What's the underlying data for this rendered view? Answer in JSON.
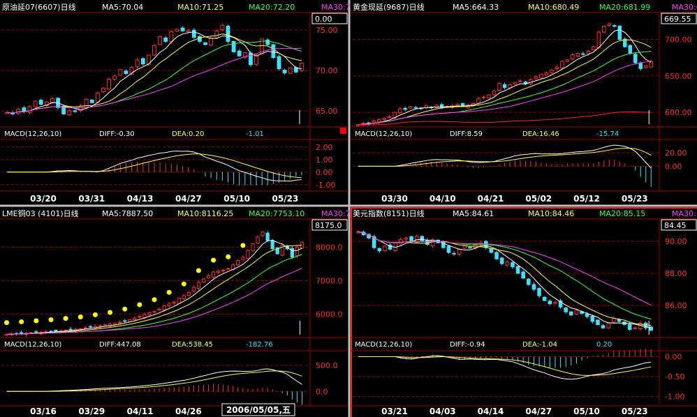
{
  "colors": {
    "up": "#ff3030",
    "down": "#40e0ff",
    "ma5": "#ffffff",
    "ma10": "#ffff40",
    "ma20": "#40ff40",
    "ma30": "#ff40ff",
    "grid": "#a00000",
    "axis_text": "#ff3030",
    "date_text": "#ffffff",
    "diff_line": "#ffffff",
    "dea_line": "#ffff40",
    "dot": "#ffff00"
  },
  "panels": [
    {
      "title": "原油延07(6607)日线",
      "ma5": "MA5:70.04",
      "ma10": "MA10:71.25",
      "ma20": "MA20:72.20",
      "ma30": "MA30:7",
      "price_box": "0.00",
      "y_ticks": [
        "75.00",
        "70.00",
        "65.00"
      ],
      "macd_label": "MACD(12,26,10)",
      "diff": "DIFF:-0.30",
      "dea": "DEA:0.20",
      "macd": "-1.01",
      "macd_ticks": [
        "2.00",
        "1.00",
        "0.00",
        "-1.00"
      ],
      "dates": [
        "03/20",
        "03/31",
        "04/13",
        "04/27",
        "05/10",
        "05/23"
      ]
    },
    {
      "title": "黄金现延(9687)日线",
      "ma5": "MA5:664.33",
      "ma10": "MA10:680.49",
      "ma20": "MA20:681.99",
      "ma30": "MA30:6",
      "price_box": "669.55",
      "y_ticks": [
        "700.00",
        "650.00",
        "600.00"
      ],
      "macd_label": "MACD(12,26,10)",
      "diff": "DIFF:8.59",
      "dea": "DEA:16.46",
      "macd": "-15.74",
      "macd_ticks": [
        "20.00",
        "0.00"
      ],
      "dates": [
        "03/30",
        "04/10",
        "04/21",
        "05/02",
        "05/12",
        "05/23"
      ]
    },
    {
      "title": "LME铜03 (4101)日线",
      "ma5": "MA5:7887.50",
      "ma10": "MA10:8116.25",
      "ma20": "MA20:7753.10",
      "ma30": "MA30:7",
      "price_box": "8175.0",
      "y_ticks": [
        "8000.0",
        "7000.0",
        "6000.0"
      ],
      "macd_label": "MACD(12,26,10)",
      "diff": "DIFF:447.08",
      "dea": "DEA:538.45",
      "macd": "-182.76",
      "macd_ticks": [
        "500.0",
        "0.0"
      ],
      "dates": [
        "03/16",
        "03/29",
        "04/11",
        "04/26",
        "2",
        "3"
      ],
      "cursor_label": "2006/05/05,五"
    },
    {
      "title": "美元指数(8151)日线",
      "ma5": "MA5:84.61",
      "ma10": "MA10:84.46",
      "ma20": "MA20:85.15",
      "ma30": "MA30:",
      "price_box": "84.45",
      "y_ticks": [
        "90.00",
        "88.00",
        "86.00"
      ],
      "macd_label": "MACD(12,26,10)",
      "diff": "DIFF:-0.94",
      "dea": "DEA:-1.04",
      "macd": "0.20",
      "macd_ticks": [
        "0.00",
        "-0.50",
        "-1.00"
      ],
      "dates": [
        "03/21",
        "04/03",
        "04/14",
        "04/27",
        "05/10",
        "05/23"
      ]
    }
  ],
  "chart_data": [
    {
      "type": "candlestick",
      "title": "原油延07(6607)日线",
      "ylim": [
        63,
        77
      ],
      "close": [
        64.8,
        64.6,
        65.2,
        64.9,
        65.5,
        66.2,
        65.8,
        66.1,
        66.5,
        65.4,
        64.6,
        65.0,
        64.9,
        65.6,
        66.4,
        66.0,
        67.2,
        67.8,
        68.9,
        69.3,
        70.1,
        69.6,
        70.4,
        71.3,
        70.8,
        71.9,
        73.1,
        74.2,
        73.6,
        74.8,
        75.1,
        74.9,
        75.0,
        74.1,
        73.6,
        73.2,
        74.0,
        74.9,
        75.6,
        73.6,
        72.3,
        71.8,
        72.2,
        70.7,
        71.9,
        73.9,
        73.2,
        71.6,
        70.2,
        69.7,
        70.3,
        69.8,
        70.9
      ],
      "volume_last": "spike",
      "macd": {
        "diff_end": -0.3,
        "dea_end": 0.2,
        "macd_end": -1.01,
        "ylim": [
          -1.4,
          2.6
        ]
      }
    },
    {
      "type": "candlestick",
      "title": "黄金现延(9687)日线",
      "ylim": [
        580,
        735
      ],
      "close": [
        583,
        585,
        584,
        588,
        590,
        592,
        594,
        600,
        605,
        604,
        608,
        606,
        605,
        609,
        607,
        610,
        606,
        608,
        609,
        611,
        608,
        610,
        612,
        619,
        621,
        624,
        629,
        640,
        634,
        638,
        641,
        643,
        639,
        645,
        649,
        652,
        654,
        658,
        662,
        670,
        672,
        679,
        681,
        680,
        684,
        690,
        710,
        718,
        721,
        719,
        700,
        690,
        681,
        668,
        660,
        664,
        670
      ],
      "macd": {
        "diff_end": 8.59,
        "dea_end": 16.46,
        "macd_end": -15.74,
        "ylim": [
          -35,
          40
        ]
      }
    },
    {
      "type": "candlestick",
      "title": "LME铜03 (4101)日线",
      "ylim": [
        5300,
        8800
      ],
      "close": [
        5395,
        5410,
        5405,
        5420,
        5430,
        5445,
        5450,
        5460,
        5470,
        5480,
        5490,
        5500,
        5520,
        5535,
        5550,
        5565,
        5590,
        5610,
        5630,
        5650,
        5680,
        5700,
        5720,
        5760,
        5800,
        5830,
        5880,
        5930,
        5990,
        6040,
        6080,
        6150,
        6250,
        6300,
        6360,
        6470,
        6550,
        6650,
        6800,
        6950,
        7050,
        7150,
        7260,
        7280,
        7310,
        7360,
        7470,
        7600,
        7700,
        7900,
        8100,
        8300,
        8450,
        8200,
        7950,
        7800,
        8050,
        7950,
        7700,
        8000,
        8150
      ],
      "dots_above": true,
      "macd": {
        "diff_end": 447.08,
        "dea_end": 538.45,
        "macd_end": -182.76,
        "ylim": [
          -250,
          780
        ]
      }
    },
    {
      "type": "candlestick",
      "title": "美元指数(8151)日线",
      "ylim": [
        84.0,
        91.3
      ],
      "close": [
        90.6,
        90.4,
        90.2,
        89.6,
        89.4,
        89.7,
        89.5,
        89.9,
        90.1,
        90.2,
        90.0,
        90.3,
        90.0,
        89.8,
        90.1,
        89.9,
        89.6,
        89.3,
        89.2,
        89.5,
        89.7,
        89.6,
        89.8,
        89.9,
        89.6,
        89.3,
        88.9,
        88.6,
        88.7,
        88.4,
        88.0,
        87.7,
        87.3,
        87.0,
        86.6,
        86.3,
        86.1,
        86.2,
        85.9,
        85.6,
        85.4,
        85.7,
        85.5,
        85.3,
        85.0,
        84.8,
        84.6,
        84.9,
        85.2,
        85.0,
        84.8,
        84.5,
        84.6,
        84.9,
        84.6,
        84.45
      ],
      "macd": {
        "diff_end": -0.94,
        "dea_end": -1.04,
        "macd_end": 0.2,
        "ylim": [
          -1.2,
          0.15
        ]
      }
    }
  ]
}
